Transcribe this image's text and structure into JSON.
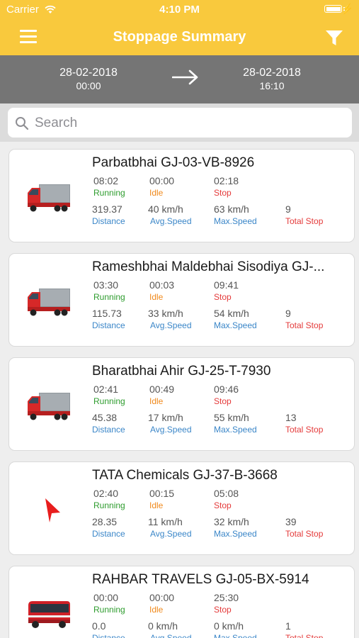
{
  "status_bar": {
    "carrier": "Carrier",
    "time": "4:10 PM"
  },
  "nav": {
    "title": "Stoppage Summary"
  },
  "date_range": {
    "from_date": "28-02-2018",
    "from_time": "00:00",
    "to_date": "28-02-2018",
    "to_time": "16:10"
  },
  "search": {
    "placeholder": "Search"
  },
  "labels": {
    "running": "Running",
    "idle": "Idle",
    "stop": "Stop",
    "distance": "Distance",
    "avg_speed": "Avg.Speed",
    "max_speed": "Max.Speed",
    "total_stop": "Total Stop"
  },
  "vehicles": [
    {
      "title": "Parbatbhai   GJ-03-VB-8926",
      "icon": "truck-icon",
      "running": "08:02",
      "idle": "00:00",
      "stop": "02:18",
      "distance": "319.37",
      "avg_speed": "40 km/h",
      "max_speed": "63 km/h",
      "total_stop": "9"
    },
    {
      "title": "Rameshbhai Maldebhai Sisodiya   GJ-...",
      "icon": "truck-icon",
      "running": "03:30",
      "idle": "00:03",
      "stop": "09:41",
      "distance": "115.73",
      "avg_speed": "33 km/h",
      "max_speed": "54 km/h",
      "total_stop": "9"
    },
    {
      "title": "Bharatbhai Ahir   GJ-25-T-7930",
      "icon": "truck-icon",
      "running": "02:41",
      "idle": "00:49",
      "stop": "09:46",
      "distance": "45.38",
      "avg_speed": "17 km/h",
      "max_speed": "55 km/h",
      "total_stop": "13"
    },
    {
      "title": "TATA Chemicals   GJ-37-B-3668",
      "icon": "navigation-arrow-icon",
      "running": "02:40",
      "idle": "00:15",
      "stop": "05:08",
      "distance": "28.35",
      "avg_speed": "11 km/h",
      "max_speed": "32 km/h",
      "total_stop": "39"
    },
    {
      "title": "RAHBAR TRAVELS   GJ-05-BX-5914",
      "icon": "bus-icon",
      "running": "00:00",
      "idle": "00:00",
      "stop": "25:30",
      "distance": "0.0",
      "avg_speed": "0 km/h",
      "max_speed": "0 km/h",
      "total_stop": "1"
    }
  ]
}
